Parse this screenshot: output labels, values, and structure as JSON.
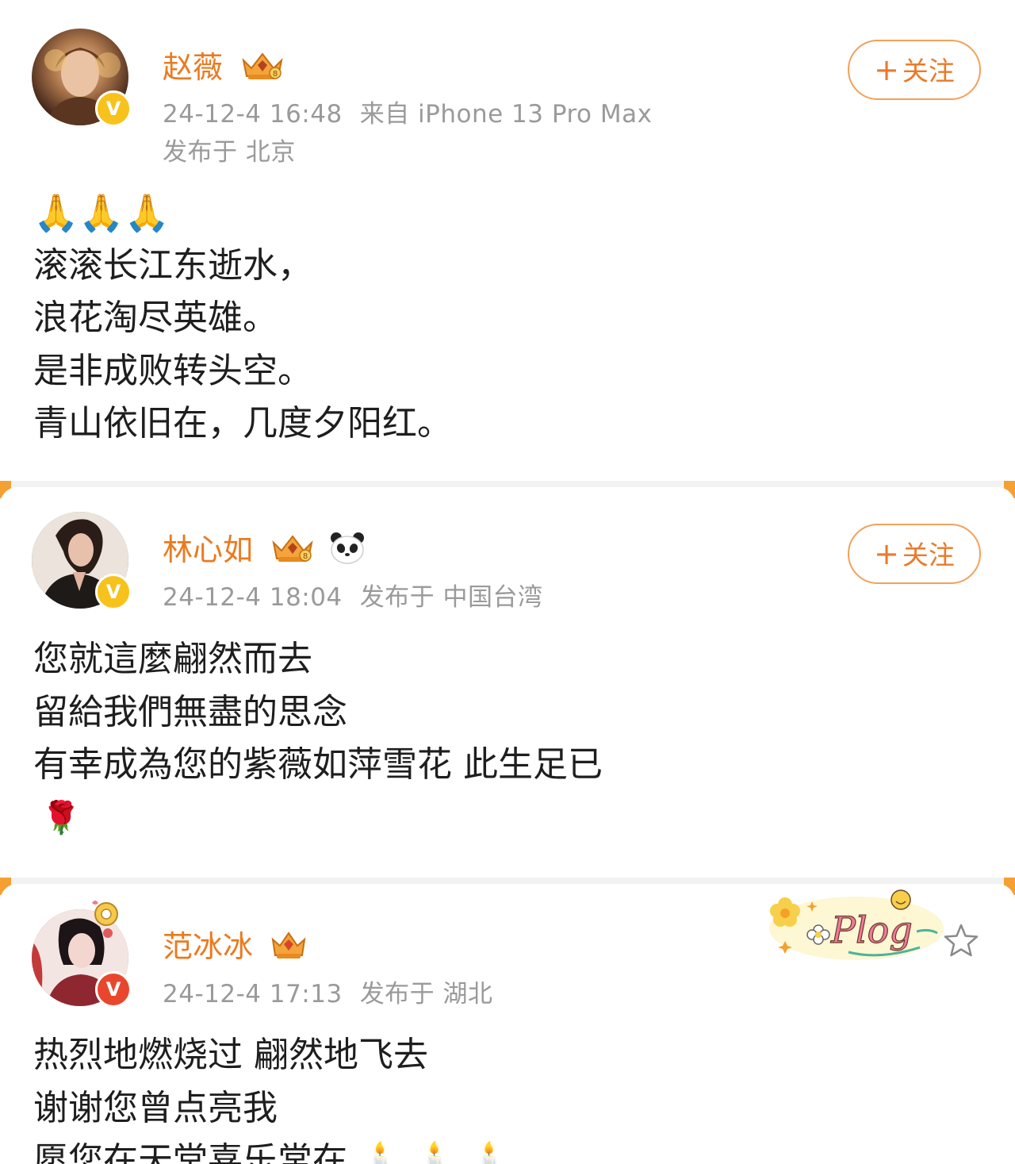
{
  "posts": [
    {
      "author": "赵薇",
      "timestamp": "24-12-4 16:48",
      "source": "来自 iPhone 13 Pro Max",
      "location": "发布于 北京",
      "follow_label": "关注",
      "emoji_line": "🙏🙏🙏",
      "lines": [
        "滚滚长江东逝水，",
        "浪花淘尽英雄。",
        "是非成败转头空。",
        "青山依旧在，几度夕阳红。"
      ]
    },
    {
      "author": "林心如",
      "timestamp": "24-12-4 18:04",
      "location": "发布于 中国台湾",
      "follow_label": "关注",
      "lines": [
        "您就這麼翩然而去",
        "留給我們無盡的思念",
        "有幸成為您的紫薇如萍雪花  此生足已"
      ],
      "emoji_line": "🌹"
    },
    {
      "author": "范冰冰",
      "timestamp": "24-12-4 17:13",
      "location": "发布于 湖北",
      "sticker_text": "Plog",
      "lines": [
        "热烈地燃烧过  翩然地飞去",
        "谢谢您曾点亮我",
        "愿您在天堂喜乐常在 🕯️ 🕯️ 🕯️"
      ]
    }
  ],
  "colors": {
    "name": "#eb7a1f",
    "meta": "#9a9a9a",
    "follow_border": "#f2a15a",
    "verify_gold": "#f7c21b",
    "verify_red": "#e8472e",
    "seam_accent": "#f5a033"
  },
  "icons": {
    "verify": "v-check-icon",
    "vip": "vip-crown-icon",
    "panda": "panda-icon",
    "favorite": "star-icon",
    "sticker": "plog-sticker"
  }
}
